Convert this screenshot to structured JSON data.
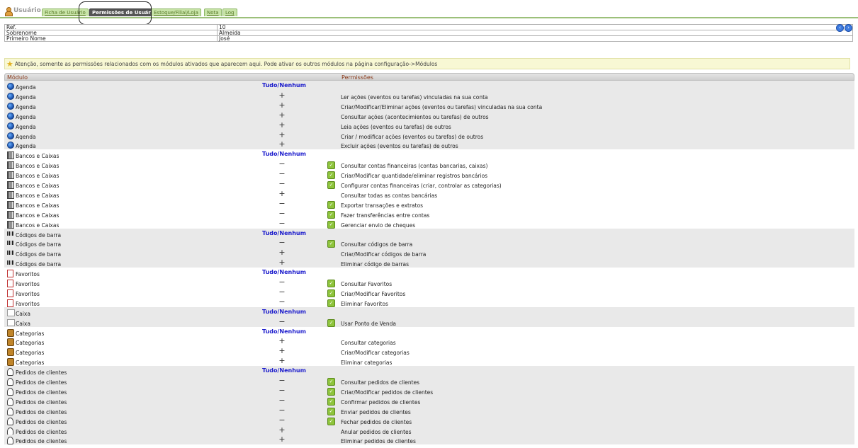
{
  "tabs": {
    "user_label": "Usuário",
    "items": [
      "Ficha de Usuário",
      "Permissões de Usuário",
      "Estoque/Filial/Loja",
      "Nota",
      "Log"
    ],
    "active_index": 1
  },
  "info": {
    "rows": [
      {
        "label": "Ref.",
        "value": "10"
      },
      {
        "label": "Sobrenome",
        "value": "Almeida"
      },
      {
        "label": "Primeiro Nome",
        "value": "José"
      }
    ],
    "nav_prev": "‹",
    "nav_next": "›"
  },
  "warning": "Atenção, somente as permissões relacionados com os módulos ativados que aparecem aqui. Pode ativar os outros módulos na página configuração->Módulos",
  "table": {
    "col_module": "Módulo",
    "col_permissions": "Permissões",
    "all_none": "Tudo/Nenhum",
    "check_icon": "checkmark-icon",
    "colors": {
      "accent_link": "#1a1acc",
      "header_text": "#8a3a1a",
      "check": "#8ec43c",
      "shade": "#e9e9e9"
    },
    "groups": [
      {
        "module": "Agenda",
        "icon": "globe-icon",
        "perms": [
          {
            "sign": "+",
            "granted": false,
            "desc": "Ler ações (eventos ou tarefas) vinculadas na sua conta"
          },
          {
            "sign": "+",
            "granted": false,
            "desc": "Criar/Modificar/Eliminar ações (eventos ou tarefas) vinculadas na sua conta"
          },
          {
            "sign": "+",
            "granted": false,
            "desc": "Consultar ações (acontecimientos ou tarefas) de outros"
          },
          {
            "sign": "+",
            "granted": false,
            "desc": "Leia ações (eventos ou tarefas) de outros"
          },
          {
            "sign": "+",
            "granted": false,
            "desc": "Criar / modificar ações (eventos ou tarefas) de outros"
          },
          {
            "sign": "+",
            "granted": false,
            "desc": "Excluir ações (eventos ou tarefas) de outros"
          }
        ]
      },
      {
        "module": "Bancos e Caixas",
        "icon": "bank-icon",
        "perms": [
          {
            "sign": "−",
            "granted": true,
            "desc": "Consultar contas financeiras (contas bancarias, caixas)"
          },
          {
            "sign": "−",
            "granted": true,
            "desc": "Criar/Modificar quantidade/eliminar registros bancários"
          },
          {
            "sign": "−",
            "granted": true,
            "desc": "Configurar contas financeiras (criar, controlar as categorias)"
          },
          {
            "sign": "+",
            "granted": false,
            "desc": "Consultar todas as contas bancárias"
          },
          {
            "sign": "−",
            "granted": true,
            "desc": "Exportar transações e extratos"
          },
          {
            "sign": "−",
            "granted": true,
            "desc": "Fazer transferências entre contas"
          },
          {
            "sign": "−",
            "granted": true,
            "desc": "Gerenciar envio de cheques"
          }
        ]
      },
      {
        "module": "Códigos de barra",
        "icon": "barcode-icon",
        "perms": [
          {
            "sign": "−",
            "granted": true,
            "desc": "Consultar códigos de barra"
          },
          {
            "sign": "+",
            "granted": false,
            "desc": "Criar/Modificar códigos de barra"
          },
          {
            "sign": "+",
            "granted": false,
            "desc": "Eliminar código de barras"
          }
        ]
      },
      {
        "module": "Favoritos",
        "icon": "bookmark-icon",
        "perms": [
          {
            "sign": "−",
            "granted": true,
            "desc": "Consultar Favoritos"
          },
          {
            "sign": "−",
            "granted": true,
            "desc": "Criar/Modificar Favoritos"
          },
          {
            "sign": "−",
            "granted": true,
            "desc": "Eliminar Favoritos"
          }
        ]
      },
      {
        "module": "Caixa",
        "icon": "cashbox-icon",
        "perms": [
          {
            "sign": "−",
            "granted": true,
            "desc": "Usar Ponto de Venda"
          }
        ]
      },
      {
        "module": "Categorias",
        "icon": "category-icon",
        "perms": [
          {
            "sign": "+",
            "granted": false,
            "desc": "Consultar categorias"
          },
          {
            "sign": "+",
            "granted": false,
            "desc": "Criar/Modificar categorias"
          },
          {
            "sign": "+",
            "granted": false,
            "desc": "Eliminar categorias"
          }
        ]
      },
      {
        "module": "Pedidos de clientes",
        "icon": "order-icon",
        "perms": [
          {
            "sign": "−",
            "granted": true,
            "desc": "Consultar pedidos de clientes"
          },
          {
            "sign": "−",
            "granted": true,
            "desc": "Criar/Modificar pedidos de clientes"
          },
          {
            "sign": "−",
            "granted": true,
            "desc": "Confirmar pedidos de clientes"
          },
          {
            "sign": "−",
            "granted": true,
            "desc": "Enviar pedidos de clientes"
          },
          {
            "sign": "−",
            "granted": true,
            "desc": "Fechar pedidos de clientes"
          },
          {
            "sign": "+",
            "granted": false,
            "desc": "Anular pedidos de clientes"
          },
          {
            "sign": "+",
            "granted": false,
            "desc": "Eliminar pedidos de clientes"
          }
        ]
      }
    ]
  }
}
